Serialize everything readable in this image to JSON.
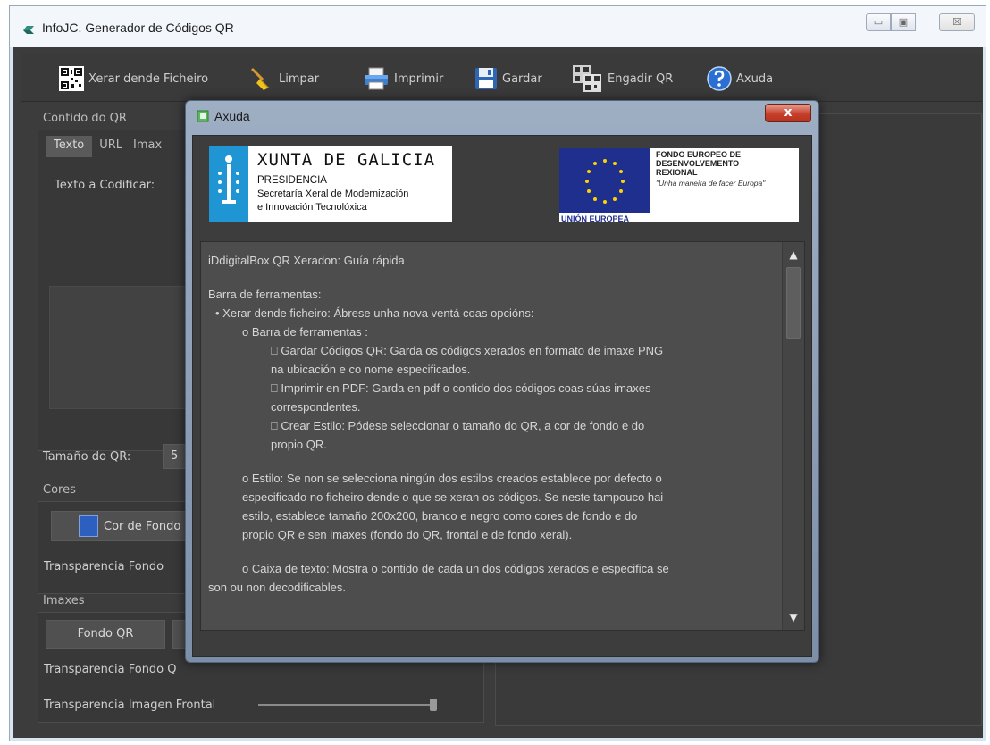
{
  "window": {
    "title": "InfoJC. Generador de Códigos QR",
    "controls": {
      "minimize": "▭",
      "maximize": "▣",
      "close": "☒"
    }
  },
  "toolbar": {
    "items": [
      {
        "label": "Xerar dende Ficheiro",
        "icon": "qr-code-icon"
      },
      {
        "label": "Limpar",
        "icon": "broom-icon"
      },
      {
        "label": "Imprimir",
        "icon": "printer-icon"
      },
      {
        "label": "Gardar",
        "icon": "floppy-disk-icon"
      },
      {
        "label": "Engadir QR",
        "icon": "add-qr-icon"
      },
      {
        "label": "Axuda",
        "icon": "help-icon"
      }
    ]
  },
  "left": {
    "content_label": "Contido do QR",
    "tabs": [
      "Texto",
      "URL",
      "Imax"
    ],
    "text_label": "Texto a Codificar:",
    "size_label": "Tamaño do QR:",
    "size_value": "5",
    "colors_label": "Cores",
    "bg_color_button": "Cor de Fondo",
    "bg_transparency_label": "Transparencia Fondo",
    "images_label": "Imaxes",
    "bg_qr_button": "Fondo QR",
    "bg_transparency_qr_label": "Transparencia Fondo Q",
    "front_transparency_label": "Transparencia Imagen Frontal"
  },
  "dialog": {
    "title": "Axuda",
    "close_label": "x",
    "logo_xunta": {
      "name": "XUNTA DE GALICIA",
      "line1": "PRESIDENCIA",
      "line2": "Secretaría Xeral de Modernización",
      "line3": "e Innovación Tecnolóxica"
    },
    "logo_eu": {
      "line1": "FONDO EUROPEO DE",
      "line2": "DESENVOLVEMENTO",
      "line3": "REXIONAL",
      "tagline": "\"Unha maneira de facer Europa\"",
      "footer": "UNIÓN EUROPEA"
    },
    "help_lines": [
      "iDdigitalBox QR Xeradon: Guía rápida",
      "",
      "Barra de ferramentas:",
      "• Xerar dende ficheiro: Ábrese unha nova ventá coas opcións:",
      "o Barra de ferramentas :",
      "⎕ Gardar Códigos QR: Garda os códigos xerados en formato de imaxe PNG",
      "na ubicación e co nome especificados.",
      "⎕ Imprimir en PDF: Garda en pdf o contido dos códigos coas súas imaxes",
      "correspondentes.",
      "⎕ Crear Estilo: Pódese seleccionar o tamaño do QR, a cor de fondo e do",
      "propio QR.",
      "",
      "o Estilo: Se non se selecciona ningún dos estilos creados establece por defecto o",
      "especificado no ficheiro dende o que se xeran os códigos.  Se neste tampouco hai",
      "estilo, establece tamaño 200x200, branco e negro como cores de fondo e do",
      "propio QR e sen imaxes (fondo do QR, frontal e de fondo xeral).",
      "",
      "o Caixa de texto: Mostra o contido de cada un dos códigos xerados e especifica se",
      "son ou non decodificables."
    ],
    "scroll_up": "▲",
    "scroll_down": "▼"
  }
}
